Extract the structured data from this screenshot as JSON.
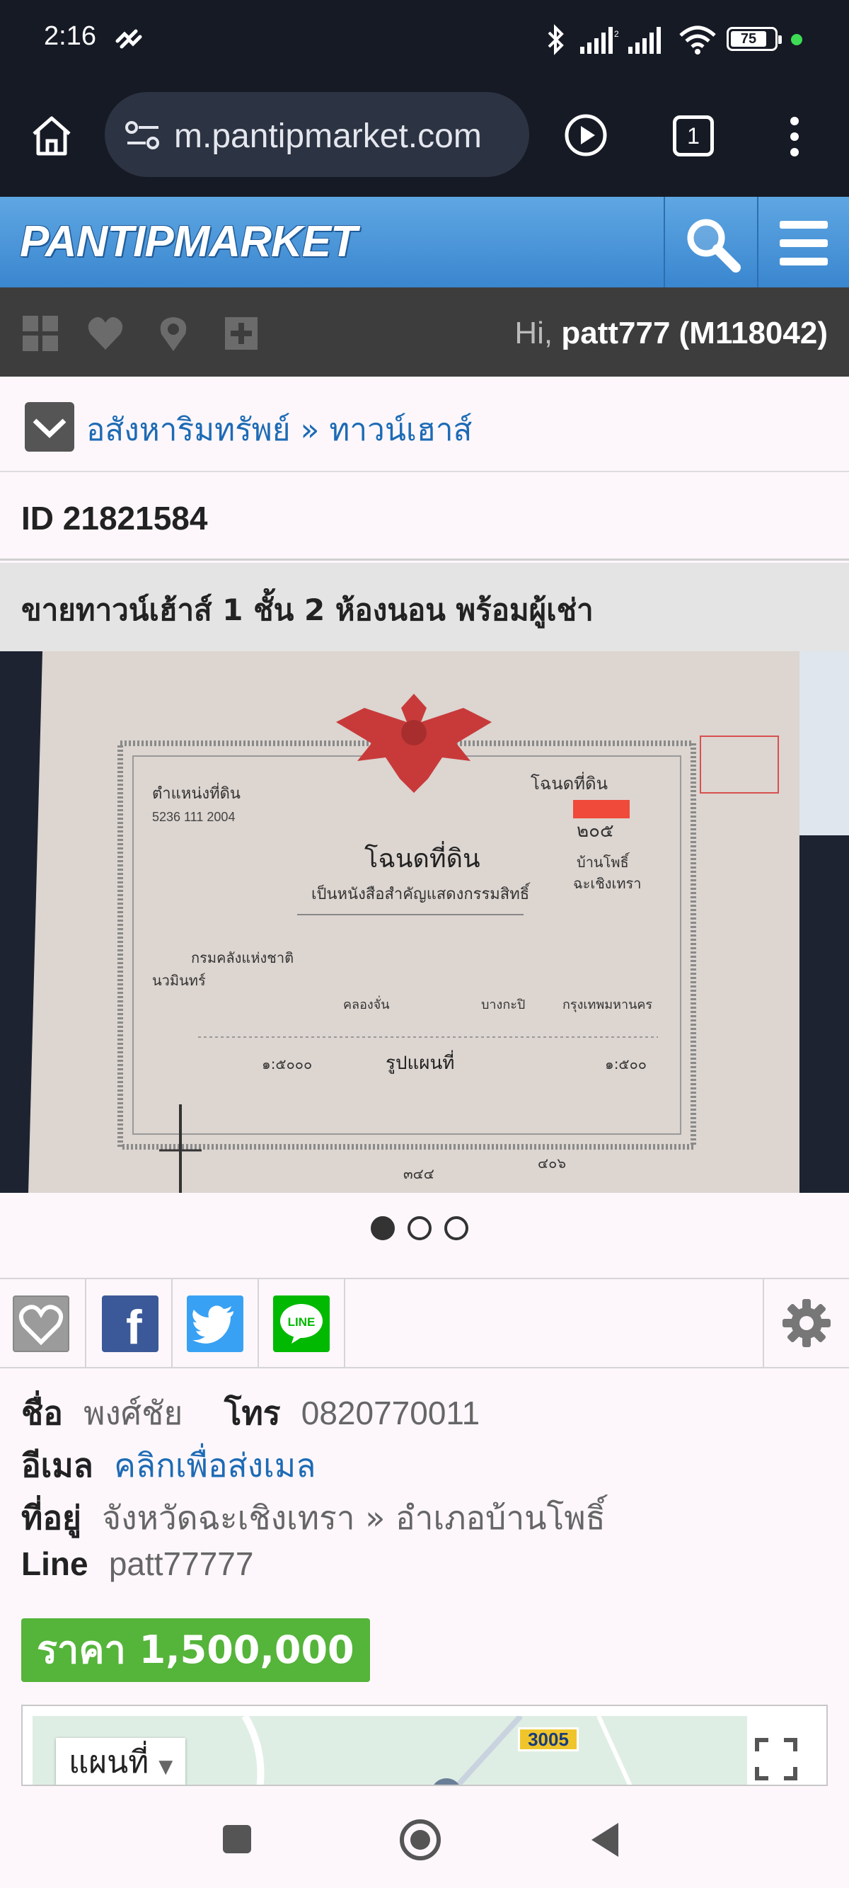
{
  "status_bar": {
    "time": "2:16",
    "battery": "75"
  },
  "browser": {
    "url": "m.pantipmarket.com",
    "tab_count": "1"
  },
  "site": {
    "logo": "PANTIPMARKET",
    "greeting": "Hi,",
    "user": "patt777 (M118042)",
    "accent_color": "#3a86cf"
  },
  "breadcrumb": "อสังหาริมทรัพย์ » ทาวน์เฮาส์",
  "listing": {
    "id": "ID 21821584",
    "title": "ขายทาวน์เฮ้าส์ 1 ชั้น 2 ห้องนอน พร้อมผู้เช่า",
    "photo": {
      "count": 3,
      "active_index": 0,
      "deed_header": "โฉนดที่ดิน",
      "deed_subtitle": "เป็นหนังสือสำคัญแสดงกรรมสิทธิ์",
      "deed_code": "5236 111 2004",
      "deed_number": "๒๐๕",
      "deed_district": "บ้านโพธิ์",
      "deed_province": "ฉะเชิงเทรา",
      "deed_owner": "กรมคลังแห่งชาติ",
      "deed_road": "นวมินทร์",
      "deed_area": "คลองจั่น",
      "deed_amphoe": "บางกะปิ",
      "deed_changwat": "กรุงเทพมหานคร",
      "deed_plan": "รูปแผนที่",
      "deed_scale1": "๑:๕๐๐๐",
      "deed_scale2": "๑:๕๐๐",
      "deed_foot": "๓๔๔",
      "deed_foot2": "๔๐๖"
    },
    "seller": {
      "name_label": "ชื่อ",
      "name": "พงศ์ชัย",
      "phone_label": "โทร",
      "phone": "0820770011",
      "email_label": "อีเมล",
      "email_link": "คลิกเพื่อส่งเมล",
      "address_label": "ที่อยู่",
      "address": "จังหวัดฉะเชิงเทรา » อำเภอบ้านโพธิ์",
      "line_label": "Line",
      "line": "patt77777"
    },
    "price": "ราคา 1,500,000"
  },
  "map": {
    "type_label": "แผนที่",
    "road_number": "3005"
  },
  "share": {
    "line_label": "LINE",
    "facebook_glyph": "f"
  }
}
